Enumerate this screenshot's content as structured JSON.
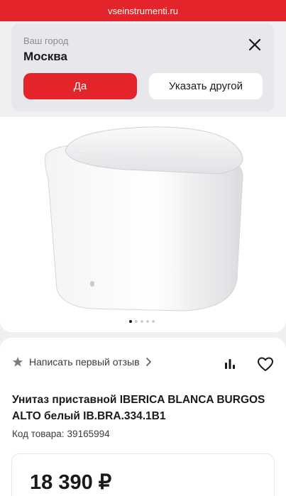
{
  "browser": {
    "url": "vseinstrumenti.ru"
  },
  "city_prompt": {
    "label": "Ваш город",
    "city": "Москва",
    "confirm_label": "Да",
    "other_label": "Указать другой"
  },
  "gallery": {
    "image_count": 5,
    "active_index": 0
  },
  "product": {
    "review_link": "Написать первый отзыв",
    "title": "Унитаз приставной IBERICA BLANCA BURGOS ALTO белый IB.BRA.334.1B1",
    "sku_label": "Код товара:",
    "sku": "39165994",
    "price": "18 390 ₽"
  },
  "colors": {
    "brand_red": "#e3242b"
  }
}
